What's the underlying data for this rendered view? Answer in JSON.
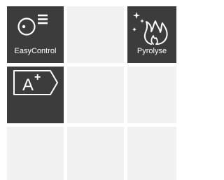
{
  "tiles": [
    {
      "label": "EasyControl",
      "icon": "easycontrol-icon",
      "style": "dark"
    },
    {
      "label": "",
      "icon": "",
      "style": "light"
    },
    {
      "label": "Pyrolyse",
      "icon": "pyrolyse-icon",
      "style": "dark"
    },
    {
      "label": "",
      "icon": "energy-class-a-plus-icon",
      "style": "dark"
    },
    {
      "label": "",
      "icon": "",
      "style": "light"
    },
    {
      "label": "",
      "icon": "",
      "style": "light"
    },
    {
      "label": "",
      "icon": "",
      "style": "light"
    },
    {
      "label": "",
      "icon": "",
      "style": "light"
    },
    {
      "label": "",
      "icon": "",
      "style": "light"
    }
  ],
  "energy_class": {
    "letter": "A",
    "superscript": "+"
  },
  "colors": {
    "dark_tile": "#3c3c3c",
    "light_tile": "#f1f1f1",
    "text": "#ffffff"
  }
}
